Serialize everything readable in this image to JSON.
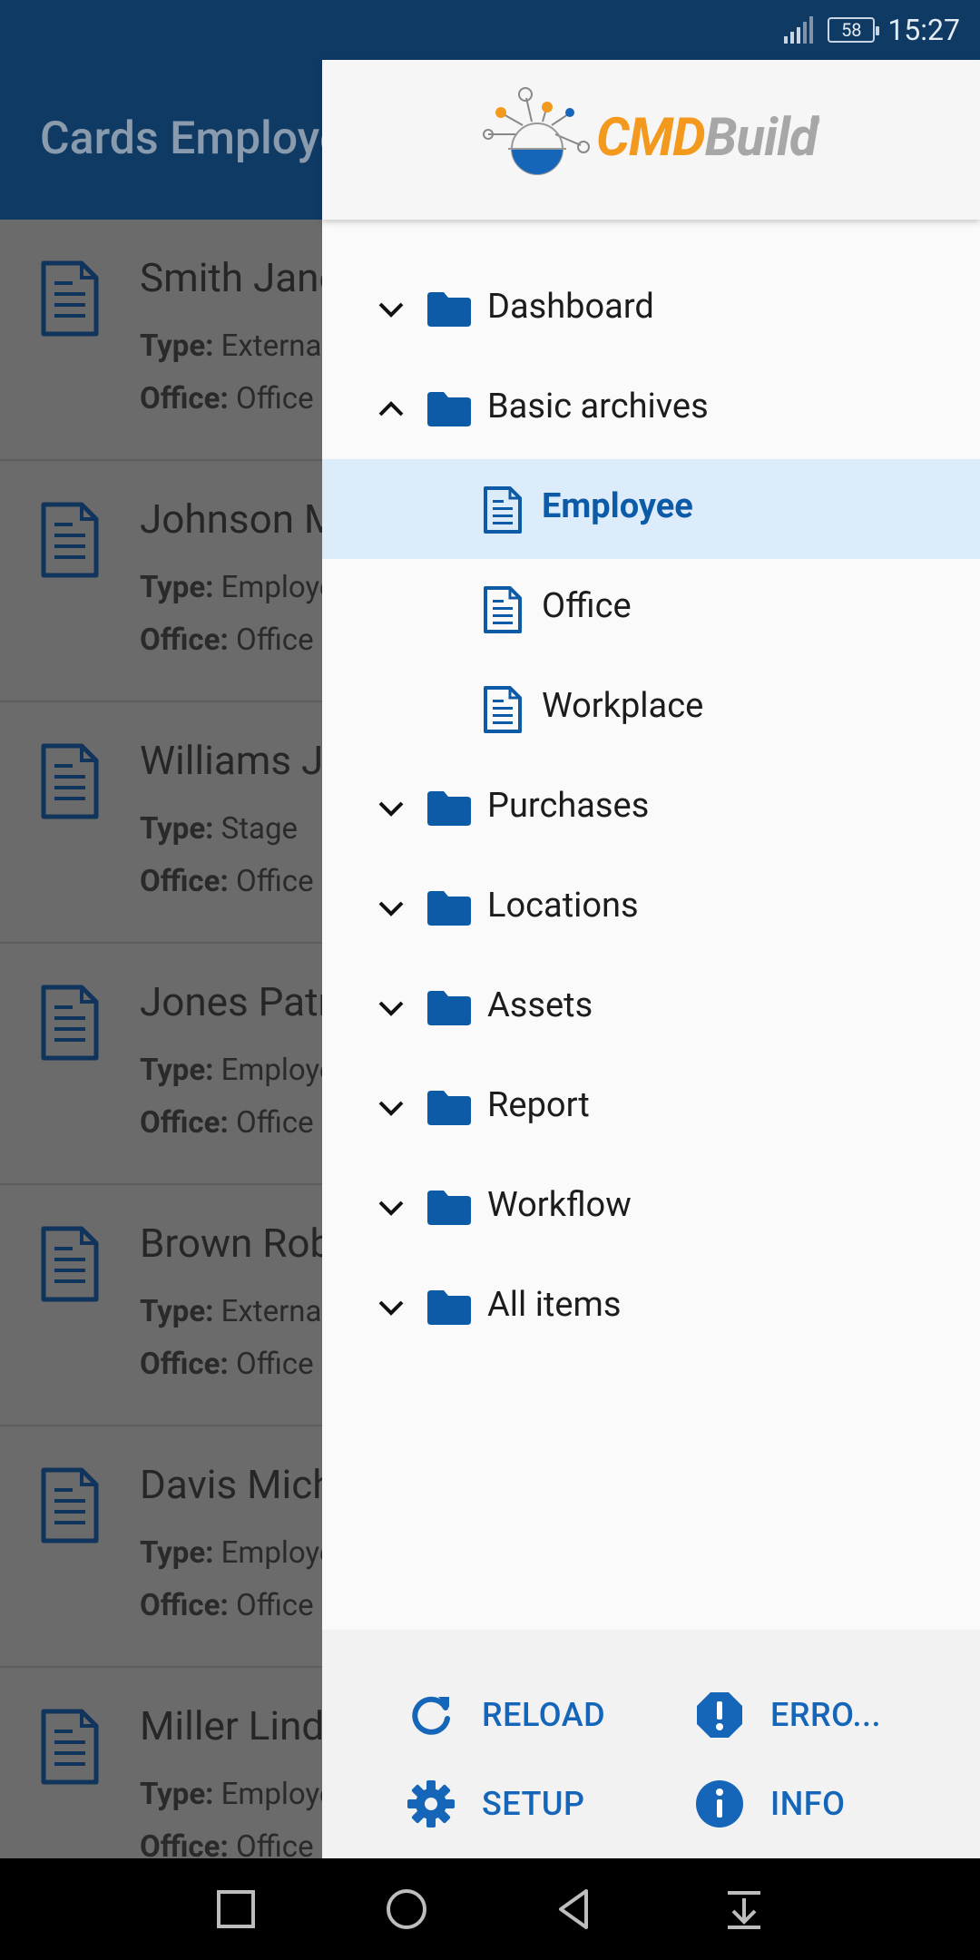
{
  "status_bar": {
    "time": "15:27",
    "battery": "58"
  },
  "app": {
    "title": "Cards Employee",
    "cards": [
      {
        "name": "Smith Jane",
        "type_label": "Type:",
        "type_value": "External",
        "office_label": "Office:",
        "office_value": "Office"
      },
      {
        "name": "Johnson Mark",
        "type_label": "Type:",
        "type_value": "Employee",
        "office_label": "Office:",
        "office_value": "Office"
      },
      {
        "name": "Williams John",
        "type_label": "Type:",
        "type_value": "Stage",
        "office_label": "Office:",
        "office_value": "Office"
      },
      {
        "name": "Jones Patricia",
        "type_label": "Type:",
        "type_value": "Employee",
        "office_label": "Office:",
        "office_value": "Office"
      },
      {
        "name": "Brown Robert",
        "type_label": "Type:",
        "type_value": "External",
        "office_label": "Office:",
        "office_value": "Office"
      },
      {
        "name": "Davis Michael",
        "type_label": "Type:",
        "type_value": "Employee",
        "office_label": "Office:",
        "office_value": "Office"
      },
      {
        "name": "Miller Linda",
        "type_label": "Type:",
        "type_value": "Employee",
        "office_label": "Office:",
        "office_value": "Office"
      }
    ]
  },
  "drawer": {
    "logo": {
      "cmd": "CMD",
      "build": "Build",
      "reg": "®"
    },
    "menu": [
      {
        "label": "Dashboard",
        "expanded": false
      },
      {
        "label": "Basic archives",
        "expanded": true
      },
      {
        "label": "Purchases",
        "expanded": false
      },
      {
        "label": "Locations",
        "expanded": false
      },
      {
        "label": "Assets",
        "expanded": false
      },
      {
        "label": "Report",
        "expanded": false
      },
      {
        "label": "Workflow",
        "expanded": false
      },
      {
        "label": "All items",
        "expanded": false
      }
    ],
    "sub_items": [
      {
        "label": "Employee",
        "active": true
      },
      {
        "label": "Office",
        "active": false
      },
      {
        "label": "Workplace",
        "active": false
      }
    ],
    "actions": {
      "reload": "RELOAD",
      "errors": "ERRO...",
      "setup": "SETUP",
      "info": "INFO"
    }
  },
  "colors": {
    "accent": "#0d5ba6",
    "header": "#0f3a64",
    "logo_orange": "#f39a1e",
    "active_bg": "#dcecfb"
  }
}
